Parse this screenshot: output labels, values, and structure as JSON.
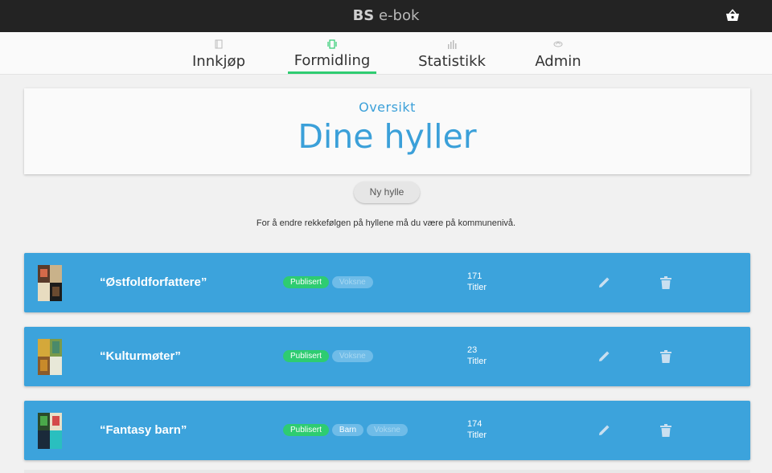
{
  "header": {
    "brand_bold": "BS",
    "brand_rest": " e-bok",
    "cart_icon": "shopping-basket-icon"
  },
  "nav": {
    "tabs": [
      {
        "label": "Innkjøp",
        "icon": "book-icon",
        "active": false
      },
      {
        "label": "Formidling",
        "icon": "carousel-icon",
        "active": true
      },
      {
        "label": "Statistikk",
        "icon": "bar-chart-icon",
        "active": false
      },
      {
        "label": "Admin",
        "icon": "handshake-icon",
        "active": false
      }
    ]
  },
  "hero": {
    "subtitle": "Oversikt",
    "title": "Dine hyller"
  },
  "actions": {
    "new_shelf": "Ny hylle"
  },
  "hint": "For å endre rekkefølgen på hyllene må du være på kommunenivå.",
  "shelves": [
    {
      "name": "“Østfoldforfattere”",
      "badges": [
        "Publisert",
        "Voksne"
      ],
      "count": "171",
      "count_label": "Titler"
    },
    {
      "name": "“Kulturmøter”",
      "badges": [
        "Publisert",
        "Voksne"
      ],
      "count": "23",
      "count_label": "Titler"
    },
    {
      "name": "“Fantasy barn”",
      "badges": [
        "Publisert",
        "Barn",
        "Voksne"
      ],
      "count": "174",
      "count_label": "Titler"
    }
  ],
  "colors": {
    "accent": "#3ba0d9",
    "shelf_bg": "#3ca3dc",
    "published_green": "#2ecc71",
    "topbar": "#232323"
  }
}
